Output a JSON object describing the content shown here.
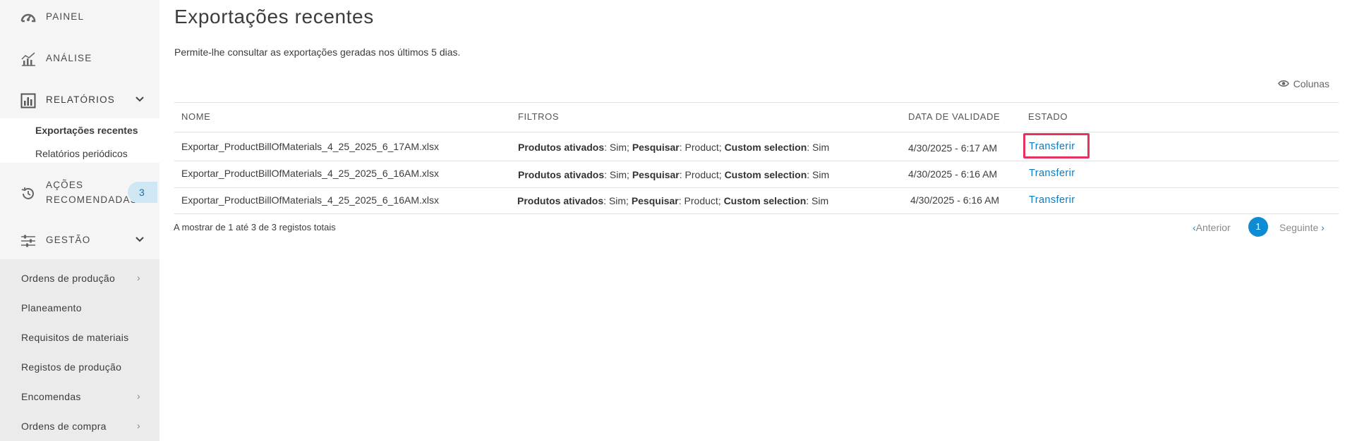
{
  "sidebar": {
    "painel": "PAINEL",
    "analise": "ANÁLISE",
    "relatorios": "RELATÓRIOS",
    "relatorios_sub": [
      "Exportações recentes",
      "Relatórios periódicos"
    ],
    "acoes_line1": "AÇÕES",
    "acoes_line2": "RECOMENDADAS",
    "acoes_badge": "3",
    "gestao": "GESTÃO",
    "gestao_items": [
      "Ordens de produção",
      "Planeamento",
      "Requisitos de materiais",
      "Registos de produção",
      "Encomendas",
      "Ordens de compra"
    ]
  },
  "main": {
    "title": "Exportações recentes",
    "description": "Permite-lhe consultar as exportações geradas nos últimos 5 dias.",
    "columns_button": "Colunas",
    "headers": [
      "NOME",
      "FILTROS",
      "DATA DE VALIDADE",
      "ESTADO"
    ],
    "rows": [
      {
        "name": "Exportar_ProductBillOfMaterials_4_25_2025_6_17AM.xlsx",
        "date": "4/30/2025 - 6:17 AM",
        "action": "Transferir"
      },
      {
        "name": "Exportar_ProductBillOfMaterials_4_25_2025_6_16AM.xlsx",
        "date": "4/30/2025 - 6:16 AM",
        "action": "Transferir"
      },
      {
        "name": "Exportar_ProductBillOfMaterials_4_25_2025_6_16AM.xlsx",
        "date": "4/30/2025 - 6:16 AM",
        "action": "Transferir"
      }
    ],
    "filter_parts": {
      "k1": "Produtos ativados",
      "v1": ": Sim; ",
      "k2": "Pesquisar",
      "v2": ": Product; ",
      "k3": "Custom selection",
      "v3": ": Sim"
    },
    "record_count": "A mostrar de 1 até 3 de 3 registos totais",
    "pager": {
      "prev": "Anterior",
      "page": "1",
      "next": "Seguinte"
    }
  }
}
